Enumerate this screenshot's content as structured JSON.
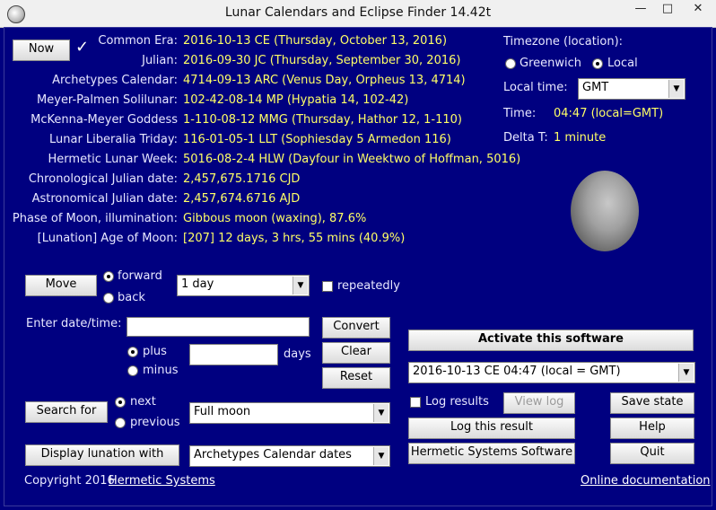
{
  "window": {
    "title": "Lunar Calendars and Eclipse Finder 14.42t",
    "minimize": "—",
    "maximize": "□",
    "close": "✕"
  },
  "calendar": {
    "now_label": "Now",
    "check_glyph": "✓",
    "rows": [
      {
        "label": "Common Era:",
        "value": "2016-10-13 CE (Thursday, October 13, 2016)"
      },
      {
        "label": "Julian:",
        "value": "2016-09-30 JC (Thursday, September 30, 2016)"
      },
      {
        "label": "Archetypes Calendar:",
        "value": "4714-09-13 ARC (Venus Day, Orpheus 13,  4714)"
      },
      {
        "label": "Meyer-Palmen Solilunar:",
        "value": "102-42-08-14 MP (Hypatia 14, 102-42)"
      },
      {
        "label": "McKenna-Meyer Goddess",
        "value": "1-110-08-12 MMG (Thursday, Hathor 12, 1-110)"
      },
      {
        "label": "Lunar Liberalia Triday:",
        "value": "116-01-05-1 LLT (Sophiesday 5 Armedon 116)"
      },
      {
        "label": "Hermetic Lunar Week:",
        "value": "5016-08-2-4 HLW (Dayfour in Weektwo of Hoffman, 5016)"
      },
      {
        "label": "Chronological Julian date:",
        "value": "2,457,675.1716 CJD"
      },
      {
        "label": "Astronomical Julian date:",
        "value": "2,457,674.6716 AJD"
      },
      {
        "label": "Phase of Moon, illumination:",
        "value": "Gibbous moon (waxing), 87.6%"
      },
      {
        "label": "[Lunation] Age of Moon:",
        "value": "[207] 12 days, 3 hrs, 55 mins (40.9%)"
      }
    ]
  },
  "timezone": {
    "heading": "Timezone (location):",
    "greenwich_label": "Greenwich",
    "local_label": "Local",
    "local_time_label": "Local time:",
    "local_time_value": "GMT",
    "time_label": "Time:",
    "time_value": "04:47 (local=GMT)",
    "delta_label": "Delta T:",
    "delta_value": "1 minute"
  },
  "move": {
    "button": "Move",
    "forward": "forward",
    "back": "back",
    "interval": "1 day",
    "repeatedly": "repeatedly"
  },
  "enter": {
    "label": "Enter date/time:",
    "input_value": "",
    "convert": "Convert",
    "plus": "plus",
    "minus": "minus",
    "days_value": "",
    "days_label": "days",
    "clear": "Clear",
    "reset": "Reset"
  },
  "search": {
    "button": "Search for",
    "next": "next",
    "previous": "previous",
    "target": "Full moon"
  },
  "lunation": {
    "button": "Display lunation with",
    "dates": "Archetypes Calendar dates"
  },
  "right_panel": {
    "activate": "Activate this software",
    "result_value": "2016-10-13 CE 04:47 (local = GMT)",
    "log_results": "Log results",
    "view_log": "View log",
    "save_state": "Save state",
    "log_this": "Log this result",
    "help": "Help",
    "hermetic": "Hermetic Systems Software",
    "quit": "Quit"
  },
  "footer": {
    "copyright": "Copyright 2016",
    "company_link": "Hermetic Systems",
    "docs_link": "Online documentation"
  }
}
